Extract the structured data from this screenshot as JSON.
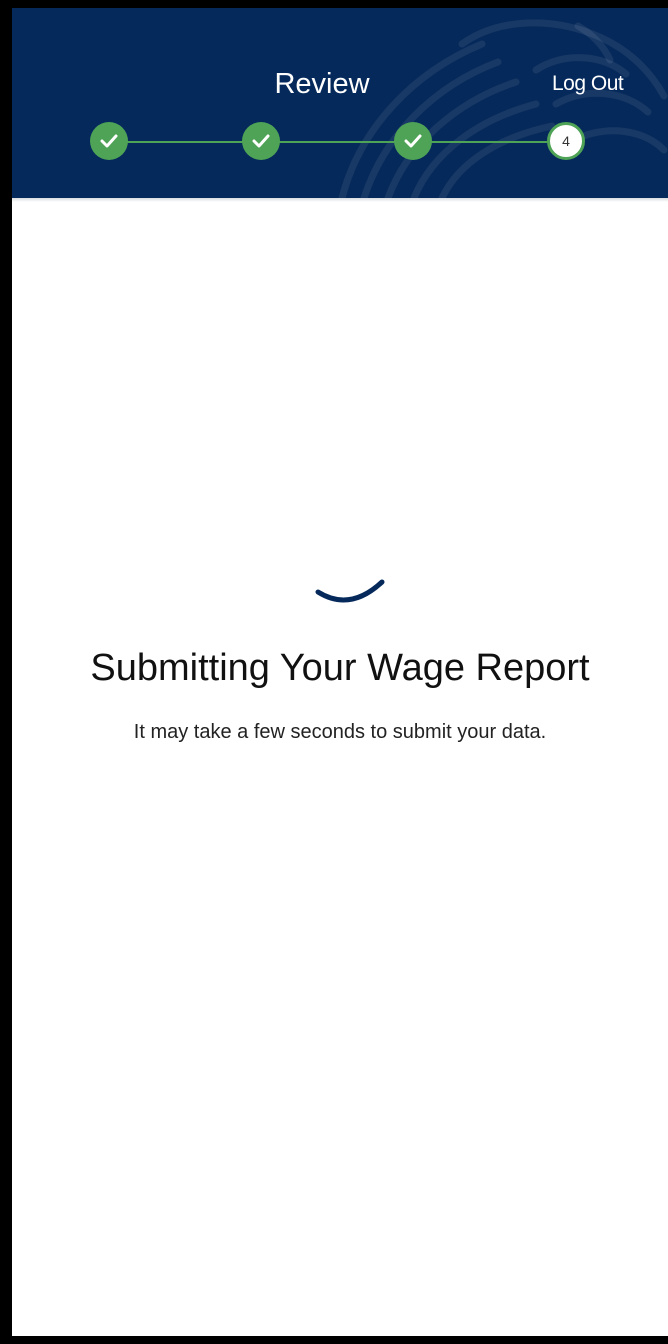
{
  "header": {
    "title": "Review",
    "logout_label": "Log Out",
    "background_color": "#05295a"
  },
  "stepper": {
    "steps": [
      {
        "status": "complete",
        "icon": "check-icon"
      },
      {
        "status": "complete",
        "icon": "check-icon"
      },
      {
        "status": "complete",
        "icon": "check-icon"
      },
      {
        "status": "current",
        "label": "4"
      }
    ],
    "complete_color": "#4ea356"
  },
  "main": {
    "spinner_icon": "loading-spinner-icon",
    "title": "Submitting Your Wage Report",
    "message": "It may take a few seconds to submit your data."
  }
}
